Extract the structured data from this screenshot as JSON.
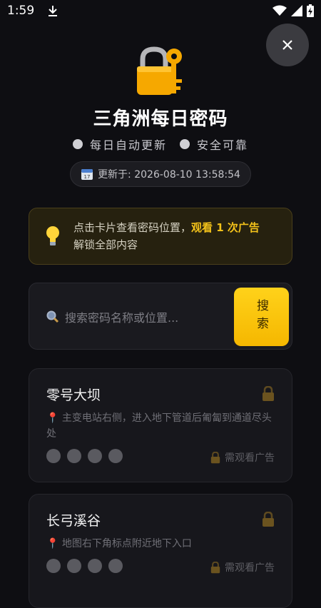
{
  "status_bar": {
    "time": "1:59"
  },
  "header": {
    "title": "三角洲每日密码",
    "tags": [
      "每日自动更新",
      "安全可靠"
    ],
    "updated_label": "更新于: 2026-08-10 13:58:54"
  },
  "notice": {
    "text_prefix": "点击卡片查看密码位置，",
    "text_highlight": "观看 1 次广告",
    "text_suffix": "解锁全部内容"
  },
  "search": {
    "placeholder": "搜索密码名称或位置...",
    "button_label": "搜索"
  },
  "cards": [
    {
      "title": "零号大坝",
      "location": "主变电站右侧，进入地下管道后匍匐到通道尽头处",
      "watch_label": "需观看广告",
      "dots": 4
    },
    {
      "title": "长弓溪谷",
      "location": "地图右下角标点附近地下入口",
      "watch_label": "需观看广告",
      "dots": 4
    }
  ],
  "colors": {
    "accent": "#f5b700",
    "background": "#0e0e12"
  }
}
